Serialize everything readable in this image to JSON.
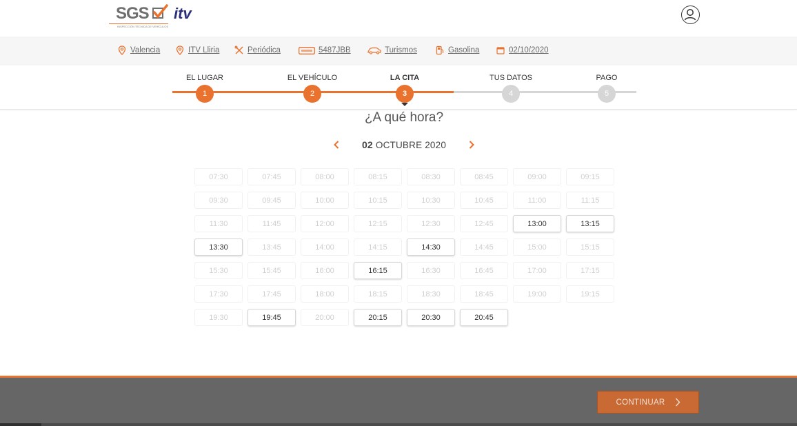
{
  "header": {
    "logo_text": "SGS",
    "logo_sub": "itv",
    "logo_tagline": "INSPECCIÓN TÉCNICA DE VEHÍCULOS",
    "user_icon": "user-icon"
  },
  "summary": [
    {
      "icon": "location-pin-icon",
      "label": "Valencia"
    },
    {
      "icon": "location-pin-icon",
      "label": "ITV Lliria"
    },
    {
      "icon": "tools-icon",
      "label": "Periódica"
    },
    {
      "icon": "license-plate-icon",
      "label": "5487JBB"
    },
    {
      "icon": "car-icon",
      "label": "Turismos"
    },
    {
      "icon": "fuel-icon",
      "label": "Gasolina"
    },
    {
      "icon": "calendar-icon",
      "label": "02/10/2020"
    }
  ],
  "steps": [
    {
      "label": "EL LUGAR",
      "num": "1",
      "state": "done"
    },
    {
      "label": "EL VEHÍCULO",
      "num": "2",
      "state": "done"
    },
    {
      "label": "LA CITA",
      "num": "3",
      "state": "current"
    },
    {
      "label": "TUS DATOS",
      "num": "4",
      "state": "todo"
    },
    {
      "label": "PAGO",
      "num": "5",
      "state": "todo"
    }
  ],
  "question": "¿A qué hora?",
  "date": {
    "day": "02",
    "month_year": "OCTUBRE 2020"
  },
  "slots": [
    {
      "t": "07:30",
      "a": false
    },
    {
      "t": "07:45",
      "a": false
    },
    {
      "t": "08:00",
      "a": false
    },
    {
      "t": "08:15",
      "a": false
    },
    {
      "t": "08:30",
      "a": false
    },
    {
      "t": "08:45",
      "a": false
    },
    {
      "t": "09:00",
      "a": false
    },
    {
      "t": "09:15",
      "a": false
    },
    {
      "t": "09:30",
      "a": false
    },
    {
      "t": "09:45",
      "a": false
    },
    {
      "t": "10:00",
      "a": false
    },
    {
      "t": "10:15",
      "a": false
    },
    {
      "t": "10:30",
      "a": false
    },
    {
      "t": "10:45",
      "a": false
    },
    {
      "t": "11:00",
      "a": false
    },
    {
      "t": "11:15",
      "a": false
    },
    {
      "t": "11:30",
      "a": false
    },
    {
      "t": "11:45",
      "a": false
    },
    {
      "t": "12:00",
      "a": false
    },
    {
      "t": "12:15",
      "a": false
    },
    {
      "t": "12:30",
      "a": false
    },
    {
      "t": "12:45",
      "a": false
    },
    {
      "t": "13:00",
      "a": true
    },
    {
      "t": "13:15",
      "a": true
    },
    {
      "t": "13:30",
      "a": true
    },
    {
      "t": "13:45",
      "a": false
    },
    {
      "t": "14:00",
      "a": false
    },
    {
      "t": "14:15",
      "a": false
    },
    {
      "t": "14:30",
      "a": true
    },
    {
      "t": "14:45",
      "a": false
    },
    {
      "t": "15:00",
      "a": false
    },
    {
      "t": "15:15",
      "a": false
    },
    {
      "t": "15:30",
      "a": false
    },
    {
      "t": "15:45",
      "a": false
    },
    {
      "t": "16:00",
      "a": false
    },
    {
      "t": "16:15",
      "a": true
    },
    {
      "t": "16:30",
      "a": false
    },
    {
      "t": "16:45",
      "a": false
    },
    {
      "t": "17:00",
      "a": false
    },
    {
      "t": "17:15",
      "a": false
    },
    {
      "t": "17:30",
      "a": false
    },
    {
      "t": "17:45",
      "a": false
    },
    {
      "t": "18:00",
      "a": false
    },
    {
      "t": "18:15",
      "a": false
    },
    {
      "t": "18:30",
      "a": false
    },
    {
      "t": "18:45",
      "a": false
    },
    {
      "t": "19:00",
      "a": false
    },
    {
      "t": "19:15",
      "a": false
    },
    {
      "t": "19:30",
      "a": false
    },
    {
      "t": "19:45",
      "a": true
    },
    {
      "t": "20:00",
      "a": false
    },
    {
      "t": "20:15",
      "a": true
    },
    {
      "t": "20:30",
      "a": true
    },
    {
      "t": "20:45",
      "a": true
    }
  ],
  "footer": {
    "continue_label": "CONTINUAR"
  },
  "colors": {
    "accent": "#e9722f",
    "footer_bg": "#666666",
    "button": "#c96a34",
    "inactive": "#d6d6d6"
  }
}
